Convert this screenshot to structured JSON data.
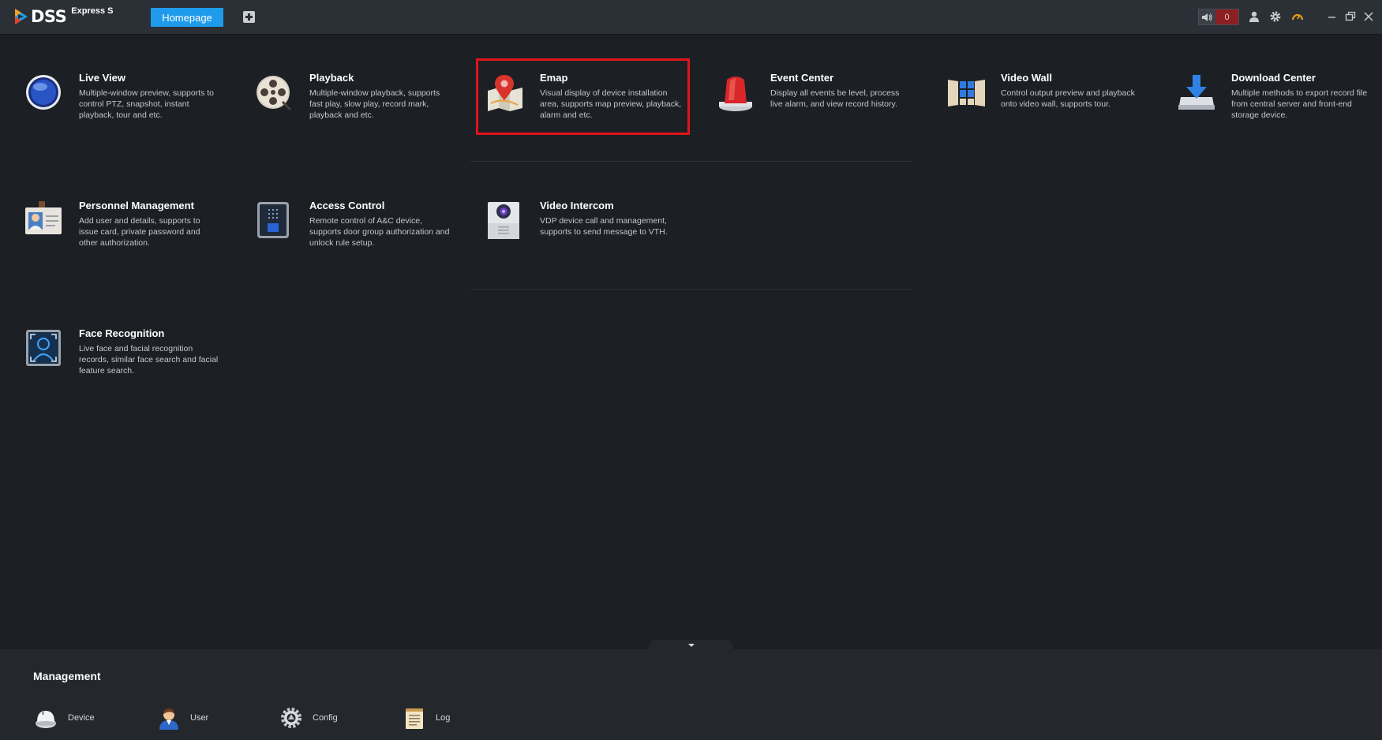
{
  "app": {
    "logo_text": "DSS",
    "logo_sub": "Express S",
    "home_tab": "Homepage",
    "alarm_count": "0"
  },
  "modules": [
    {
      "title": "Live View",
      "desc": "Multiple-window preview, supports to control PTZ, snapshot, instant playback, tour and etc."
    },
    {
      "title": "Playback",
      "desc": "Multiple-window playback, supports fast play, slow play, record mark, playback and etc."
    },
    {
      "title": "Emap",
      "desc": "Visual display of device installation area, supports map preview, playback, alarm and etc."
    },
    {
      "title": "Event Center",
      "desc": "Display all events be level, process live alarm, and view record history."
    },
    {
      "title": "Video Wall",
      "desc": "Control output preview and playback onto video wall, supports tour."
    },
    {
      "title": "Download Center",
      "desc": "Multiple methods to export record file from central server and front-end storage device."
    },
    {
      "title": "Personnel Management",
      "desc": "Add user and details, supports to issue card, private password and other authorization."
    },
    {
      "title": "Access Control",
      "desc": "Remote control of A&C device, supports door group authorization and unlock rule setup."
    },
    {
      "title": "Video Intercom",
      "desc": "VDP device call and management, supports to send message to VTH."
    },
    {
      "title": "Face Recognition",
      "desc": "Live face and facial recognition records, similar face search and facial feature search."
    }
  ],
  "management": {
    "title": "Management",
    "items": [
      {
        "label": "Device"
      },
      {
        "label": "User"
      },
      {
        "label": "Config"
      },
      {
        "label": "Log"
      }
    ]
  }
}
